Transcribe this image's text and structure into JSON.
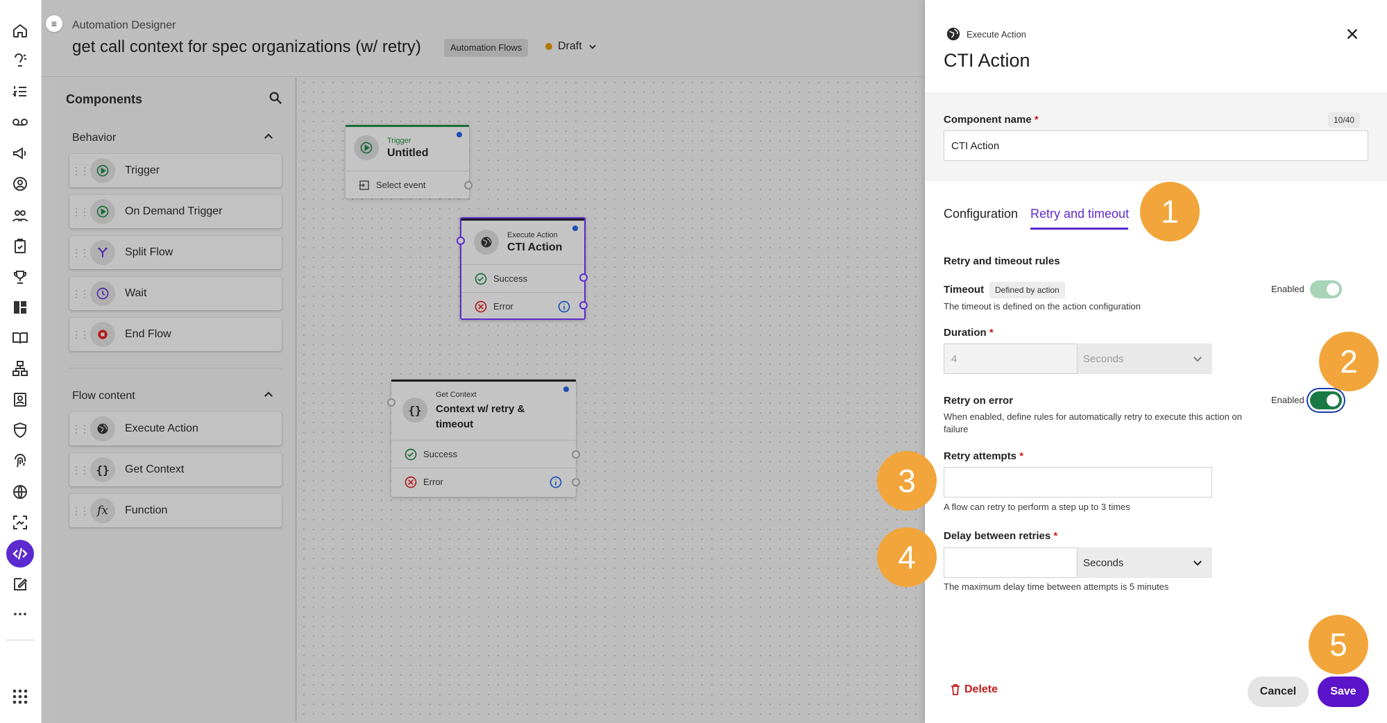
{
  "header": {
    "subtitle": "Automation Designer",
    "title": "get call context for spec organizations (w/ retry)",
    "chip": "Automation Flows",
    "status": "Draft",
    "status_color": "#b37800"
  },
  "rail": {
    "icons": [
      "home-icon",
      "speech-icon",
      "list-numbered-icon",
      "voicemail-icon",
      "megaphone-icon",
      "agent-icon",
      "users-icon",
      "clipboard-icon",
      "trophy-icon",
      "dashboard-icon",
      "book-icon",
      "workflow-icon",
      "contact-card-icon",
      "shield-icon",
      "fingerprint-icon",
      "globe-icon",
      "scan-icon",
      "code-icon",
      "edit-icon",
      "more-icon",
      "apps-grid-icon"
    ],
    "active": "code-icon"
  },
  "components": {
    "title": "Components",
    "groups": [
      {
        "title": "Behavior",
        "items": [
          "Trigger",
          "On Demand Trigger",
          "Split Flow",
          "Wait",
          "End Flow"
        ]
      },
      {
        "title": "Flow content",
        "items": [
          "Execute Action",
          "Get Context",
          "Function"
        ]
      }
    ]
  },
  "canvas": {
    "nodes": {
      "trigger": {
        "kicker": "Trigger",
        "title": "Untitled",
        "row": "Select event"
      },
      "cti": {
        "kicker": "Execute Action",
        "title": "CTI Action",
        "success": "Success",
        "error": "Error"
      },
      "context": {
        "kicker": "Get Context",
        "title_line1": "Context w/ retry &",
        "title_line2": "timeout",
        "success": "Success",
        "error": "Error"
      }
    }
  },
  "panel": {
    "kicker": "Execute Action",
    "title": "CTI Action",
    "component_name_label": "Component name",
    "component_name_counter": "10/40",
    "component_name_value": "CTI Action",
    "tabs": [
      "Configuration",
      "Retry and timeout"
    ],
    "active_tab": "Retry and timeout",
    "section_title": "Retry and timeout rules",
    "timeout": {
      "label": "Timeout",
      "tag": "Defined by action",
      "desc": "The timeout is defined on the action configuration",
      "enabled_label": "Enabled"
    },
    "duration": {
      "label": "Duration",
      "value": "4",
      "unit": "Seconds"
    },
    "retry": {
      "label": "Retry on error",
      "desc_line1": "When enabled, define rules for automatically retry to execute this action on",
      "desc_line2": "failure",
      "enabled_label": "Enabled"
    },
    "attempts": {
      "label": "Retry attempts",
      "value": "",
      "hint": "A flow can retry to perform a step up to 3 times"
    },
    "delay": {
      "label": "Delay between retries",
      "value": "",
      "unit": "Seconds",
      "hint": "The maximum delay time between attempts is 5 minutes"
    },
    "buttons": {
      "delete": "Delete",
      "cancel": "Cancel",
      "save": "Save"
    }
  },
  "callouts": [
    "1",
    "2",
    "3",
    "4",
    "5"
  ],
  "colors": {
    "accent": "#5b2bcf",
    "callout": "#f2a53a",
    "danger": "#c41b1b",
    "toggle_on": "#1a7a45"
  }
}
